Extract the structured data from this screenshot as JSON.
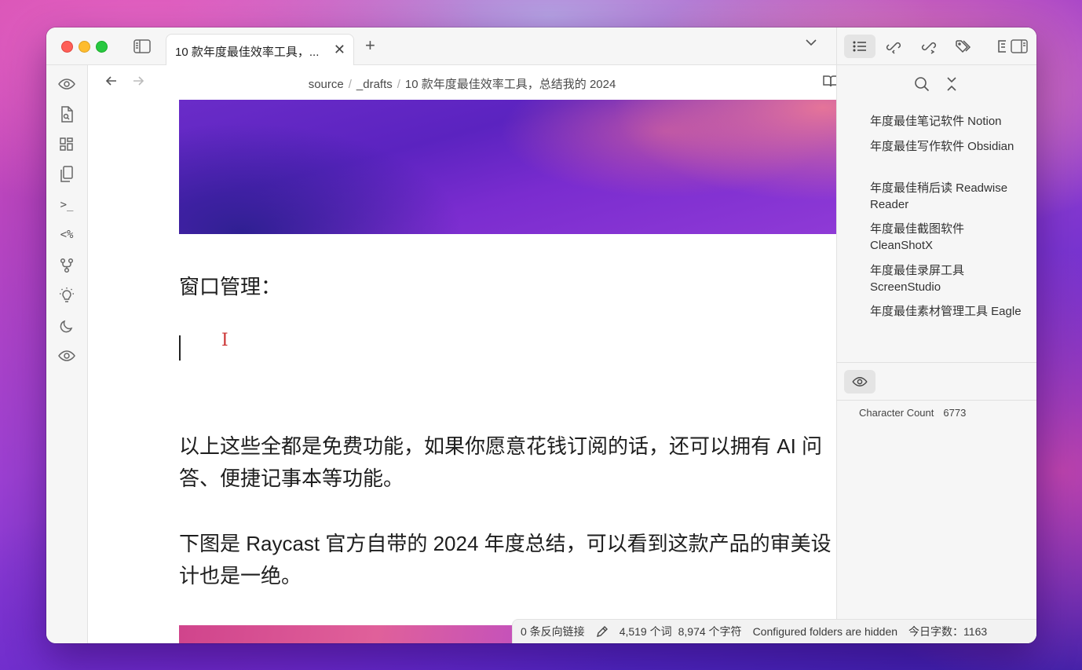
{
  "tab": {
    "title": "10 款年度最佳效率工具，...",
    "close": "✕",
    "new": "+"
  },
  "breadcrumb": {
    "root": "source",
    "sep": "/",
    "folder": "_drafts",
    "current": "10 款年度最佳效率工具，总结我的 2024"
  },
  "ribbon": {
    "templates_label": "<%",
    "terminal_label": ">_"
  },
  "editor": {
    "heading": "窗口管理：",
    "para1": "以上这些全都是免费功能，如果你愿意花钱订阅的话，还可以拥有 AI 问答、便捷记事本等功能。",
    "para2": "下图是 Raycast 官方自带的 2024 年度总结，可以看到这款产品的审美设计也是一绝。",
    "ibeam": "I"
  },
  "outline": [
    "年度最佳笔记软件 Notion",
    "年度最佳写作软件 Obsidian",
    "年度最佳稍后读 Readwise Reader",
    "年度最佳截图软件 CleanShotX",
    "年度最佳录屏工具 ScreenStudio",
    "年度最佳素材管理工具 Eagle"
  ],
  "stats": {
    "label": "Character Count",
    "value": "6773"
  },
  "status_bar": {
    "backlinks": "0 条反向链接",
    "words": "4,519 个词",
    "chars": "8,974 个字符",
    "folders": "Configured folders are hidden",
    "today": "今日字数：1163"
  },
  "colors": {
    "accent_purple": "#6a2cc8",
    "traffic_red": "#fe5f57",
    "traffic_yellow": "#febc2e",
    "traffic_green": "#28c840"
  }
}
